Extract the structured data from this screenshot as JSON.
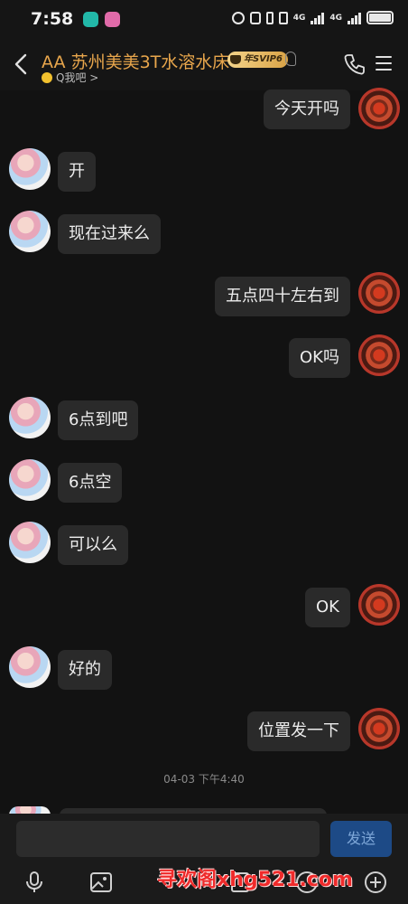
{
  "status_bar": {
    "time": "7:58",
    "network_label_1": "4G",
    "network_label_2": "4G"
  },
  "header": {
    "title": "AA 苏州美美3T水溶水床",
    "badge": "年SVIP6",
    "subtitle": "Q我吧 >",
    "title_color": "#e8a64c"
  },
  "messages": [
    {
      "side": "right",
      "text": "今天开吗"
    },
    {
      "side": "left",
      "text": "开"
    },
    {
      "side": "left",
      "text": "现在过来么"
    },
    {
      "side": "right",
      "text": "五点四十左右到"
    },
    {
      "side": "right",
      "text": "OK吗"
    },
    {
      "side": "left",
      "text": "6点到吧"
    },
    {
      "side": "left",
      "text": "6点空"
    },
    {
      "side": "left",
      "text": "可以么"
    },
    {
      "side": "right",
      "text": "OK"
    },
    {
      "side": "left",
      "text": "好的"
    },
    {
      "side": "right",
      "text": "位置发一下"
    }
  ],
  "timestamp": "04-03 下午4:40",
  "input": {
    "value": "",
    "send_label": "发送"
  },
  "toolbar_icons": [
    "microphone-icon",
    "image-icon",
    "emoji-icon",
    "file-icon",
    "plus-icon"
  ],
  "watermark": "寻欢阁xhg521.com"
}
